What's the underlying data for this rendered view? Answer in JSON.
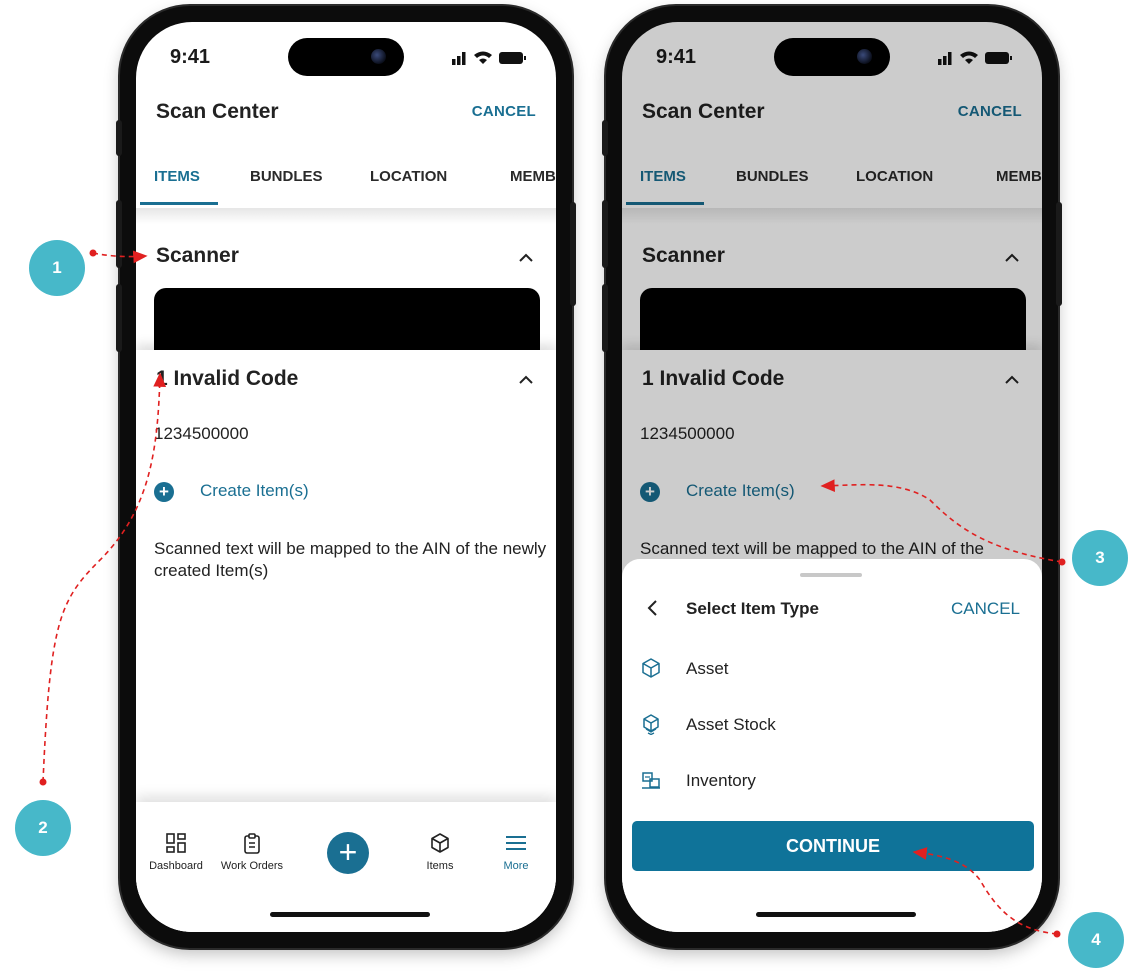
{
  "status_time": "9:41",
  "header": {
    "title": "Scan Center",
    "cancel_label": "CANCEL"
  },
  "tabs": [
    {
      "label": "ITEMS",
      "active": true
    },
    {
      "label": "BUNDLES"
    },
    {
      "label": "LOCATION"
    },
    {
      "label": "MEMBER"
    }
  ],
  "scanner": {
    "title": "Scanner"
  },
  "invalid": {
    "title": "1 Invalid Code",
    "code": "1234500000",
    "create_label": "Create Item(s)",
    "description": "Scanned text will be mapped to the AIN of the newly created Item(s)",
    "description_truncated": "Scanned text will be mapped to the AIN of the"
  },
  "bottom_nav": [
    {
      "label": "Dashboard",
      "icon": "dashboard-icon"
    },
    {
      "label": "Work Orders",
      "icon": "clipboard-icon"
    },
    {
      "label": "",
      "icon": "plus-icon"
    },
    {
      "label": "Items",
      "icon": "box-icon"
    },
    {
      "label": "More",
      "icon": "menu-icon",
      "active": true
    }
  ],
  "sheet": {
    "title": "Select Item Type",
    "cancel_label": "CANCEL",
    "types": [
      {
        "label": "Asset",
        "icon": "cube-icon"
      },
      {
        "label": "Asset Stock",
        "icon": "cubes-icon"
      },
      {
        "label": "Inventory",
        "icon": "inventory-icon"
      }
    ],
    "continue_label": "CONTINUE"
  },
  "annotations": [
    "1",
    "2",
    "3",
    "4"
  ],
  "colors": {
    "primary": "#1a6f92",
    "button": "#0f7399",
    "badge": "#47b8c9",
    "arrow": "#e02020"
  }
}
